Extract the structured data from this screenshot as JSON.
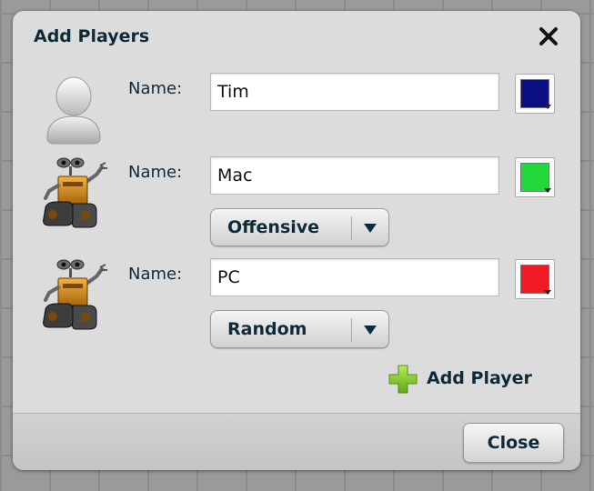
{
  "dialog": {
    "title": "Add Players",
    "close_icon": "close-x-icon",
    "add_player_label": "Add Player",
    "add_player_icon": "green-plus-icon",
    "close_button_label": "Close"
  },
  "players": [
    {
      "name_label": "Name:",
      "name": "Tim",
      "avatar": "human-user-icon",
      "color": "#0b0e80"
    },
    {
      "name_label": "Name:",
      "name": "Mac",
      "avatar": "robot-walle-icon",
      "color": "#22d83a",
      "strategy": "Offensive"
    },
    {
      "name_label": "Name:",
      "name": "PC",
      "avatar": "robot-walle-icon",
      "color": "#f01a24",
      "strategy": "Random"
    }
  ]
}
